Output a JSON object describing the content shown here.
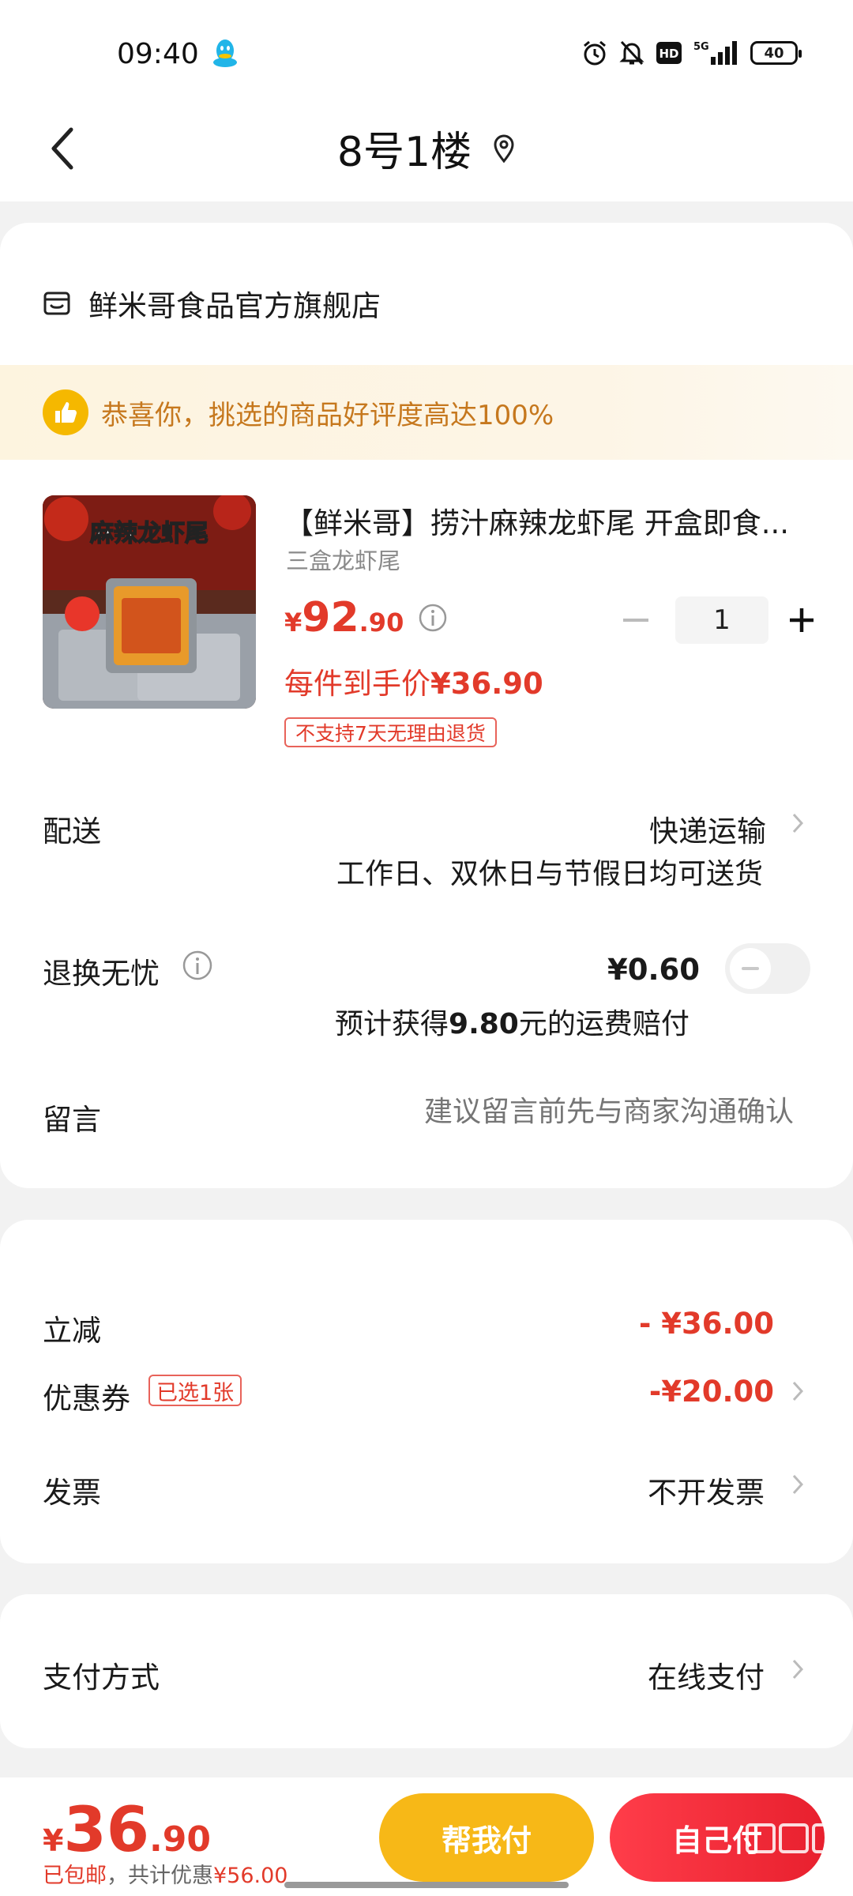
{
  "status_bar": {
    "time": "09:40",
    "battery": "40",
    "network": "5G"
  },
  "header": {
    "title": "8号1楼"
  },
  "store": {
    "name": "鲜米哥食品官方旗舰店"
  },
  "banner": {
    "text": "恭喜你，挑选的商品好评度高达100%"
  },
  "product": {
    "image_text": "麻辣龙虾尾",
    "title": "【鲜米哥】捞汁麻辣龙虾尾 开盒即食...",
    "spec": "三盒龙虾尾",
    "price_symbol": "¥",
    "price_int": "92",
    "price_dec": ".90",
    "quantity": "1",
    "hand_price_label": "每件到手价",
    "hand_price_value": "¥36.90",
    "no_return_tag": "不支持7天无理由退货"
  },
  "delivery": {
    "label": "配送",
    "value": "快递运输",
    "note": "工作日、双休日与节假日均可送货"
  },
  "return_insurance": {
    "label": "退换无忧",
    "price": "¥0.60",
    "note_prefix": "预计获得",
    "note_amount": "9.80",
    "note_suffix": "元的运费赔付"
  },
  "message": {
    "label": "留言",
    "placeholder": "建议留言前先与商家沟通确认"
  },
  "discounts": {
    "instant_label": "立减",
    "instant_value": "- ¥36.00",
    "coupon_label": "优惠券",
    "coupon_tag": "已选1张",
    "coupon_value": "-¥20.00",
    "invoice_label": "发票",
    "invoice_value": "不开发票"
  },
  "payment": {
    "label": "支付方式",
    "value": "在线支付"
  },
  "bottom": {
    "total_symbol": "¥",
    "total_int": "36",
    "total_dec": ".90",
    "shipping_note": "已包邮",
    "discount_note_prefix": "，共计优惠",
    "discount_total": "¥56.00",
    "help_pay": "帮我付",
    "self_pay": "自己付"
  },
  "colors": {
    "accent_red": "#e23a2a",
    "help_button": "#f7b817",
    "pay_button": "#e8202e",
    "banner_text": "#c6781e"
  }
}
